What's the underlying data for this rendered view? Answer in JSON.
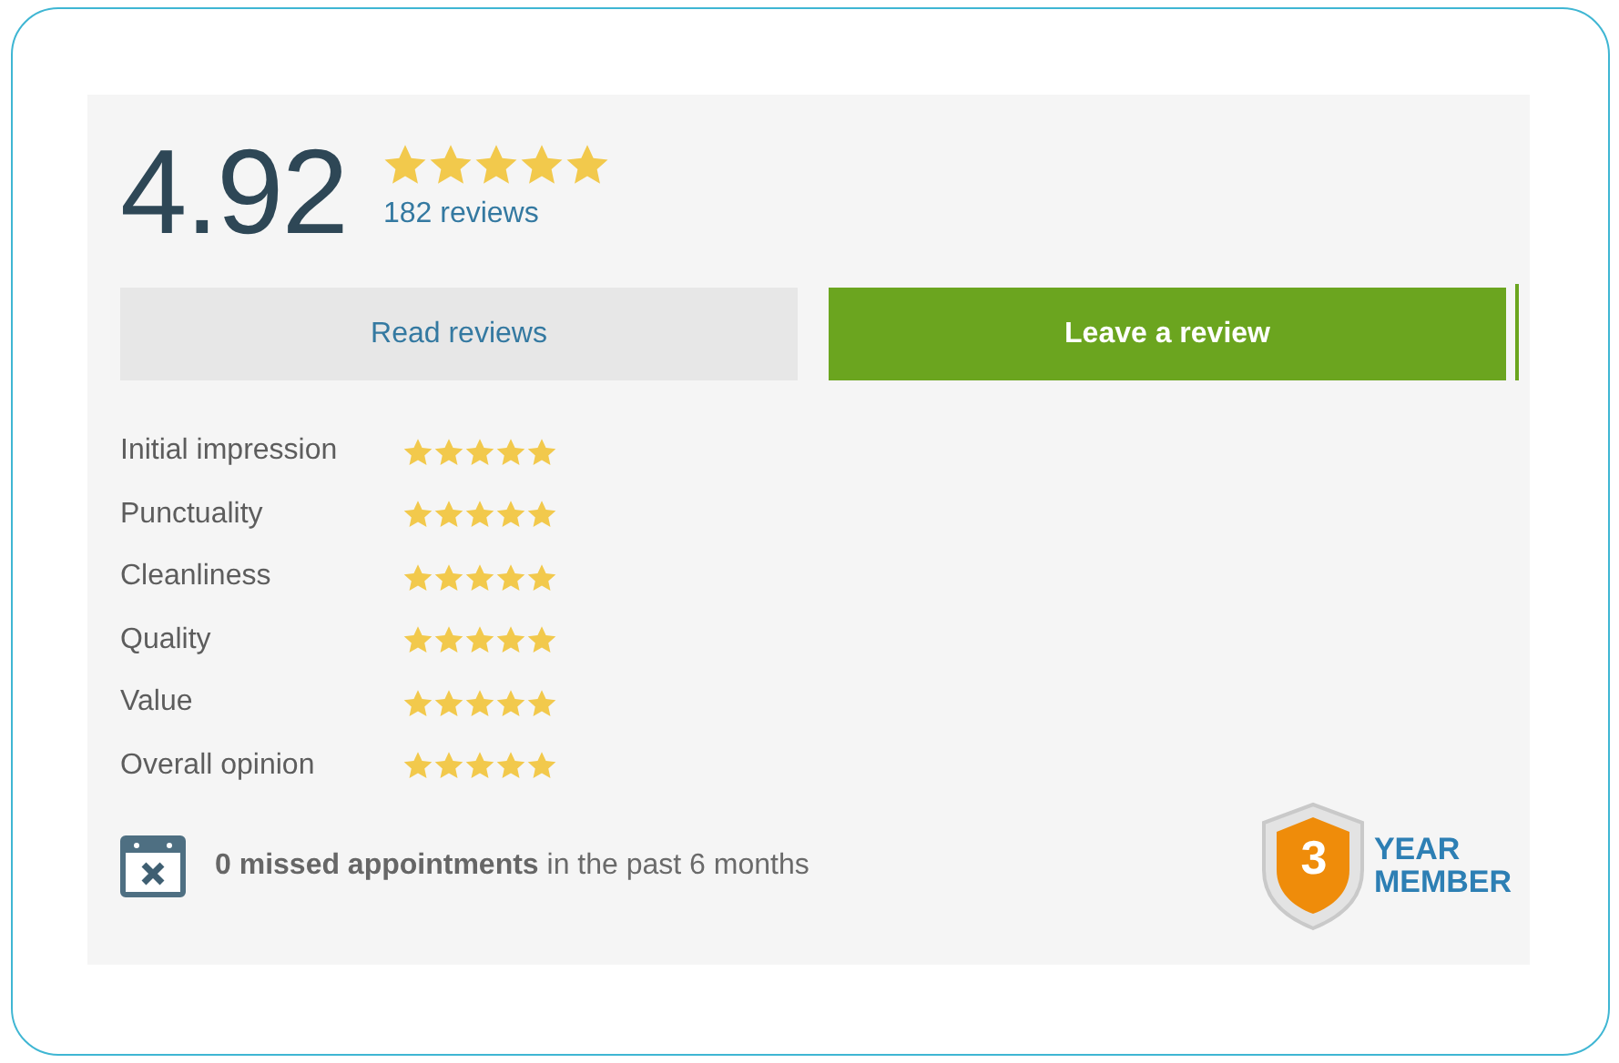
{
  "summary": {
    "score": "4.92",
    "stars": 5,
    "review_count": "182 reviews"
  },
  "buttons": [
    {
      "label": "Read reviews",
      "kind": "secondary"
    },
    {
      "label": "Leave a review",
      "kind": "primary"
    }
  ],
  "categories": [
    {
      "name": "Initial impression",
      "stars": 5
    },
    {
      "name": "Punctuality",
      "stars": 5
    },
    {
      "name": "Cleanliness",
      "stars": 5
    },
    {
      "name": "Quality",
      "stars": 5
    },
    {
      "name": "Value",
      "stars": 5
    },
    {
      "name": "Overall opinion",
      "stars": 5
    }
  ],
  "missed_appointments": "**0 missed appointments** in the past 6 months",
  "member_badge": {
    "number": "3",
    "lines": [
      "YEAR",
      "MEMBER"
    ]
  }
}
